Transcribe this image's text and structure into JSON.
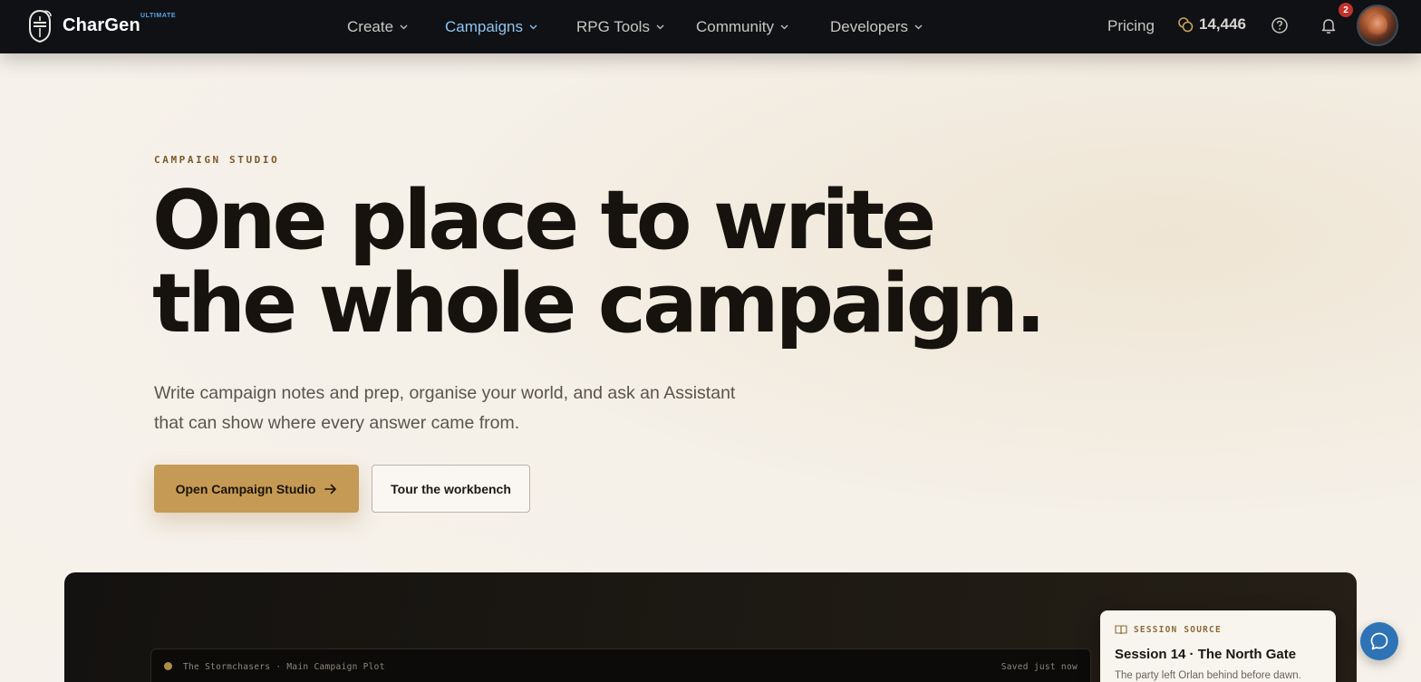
{
  "nav": {
    "brand": "CharGen",
    "badge": "ULTIMATE",
    "items": [
      {
        "label": "Create",
        "active": false
      },
      {
        "label": "Campaigns",
        "active": true
      },
      {
        "label": "RPG Tools",
        "active": false
      },
      {
        "label": "Community",
        "active": false
      },
      {
        "label": "Developers",
        "active": false
      }
    ],
    "pricing": "Pricing",
    "credits": "14,446",
    "notification_count": "2",
    "icons": {
      "logo": "knight-helmet-logo",
      "credits": "coins-icon",
      "help": "help-circle-icon",
      "notifications": "bell-icon",
      "dropdown": "chevron-down-icon"
    },
    "colors": {
      "background": "#0f1115",
      "active": "#8fc4ee",
      "badge": "#c0322b"
    }
  },
  "hero": {
    "eyebrow": "CAMPAIGN STUDIO",
    "headline_line1": "One place to write",
    "headline_line2": "the whole campaign.",
    "subcopy_line1": "Write campaign notes and prep, organise your world, and ask an Assistant",
    "subcopy_line2": "that can show where every answer came from.",
    "primary_cta": "Open Campaign Studio",
    "secondary_cta": "Tour the workbench",
    "colors": {
      "primary_button": "#c49a55",
      "eyebrow": "#7a5a2a"
    }
  },
  "preview": {
    "editor_title": "The Stormchasers · Main Campaign Plot",
    "editor_status": "Saved just now",
    "source_label": "SESSION SOURCE",
    "source_title": "Session 14 · The North Gate",
    "source_excerpt": "The party left Orlan behind before dawn.",
    "icons": {
      "source": "book-icon",
      "chat": "chat-bubble-icon"
    }
  }
}
